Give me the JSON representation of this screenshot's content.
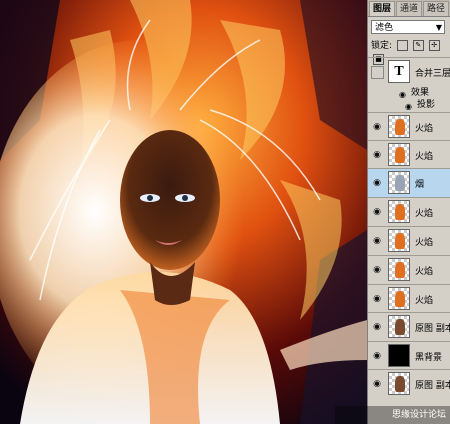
{
  "tabs": [
    "图层",
    "通道",
    "路径"
  ],
  "blend_mode": "滤色",
  "lock_label": "锁定:",
  "text_layer": {
    "thumb": "T",
    "name": "合并三层"
  },
  "effects": {
    "label": "效果",
    "drop_shadow": "投影"
  },
  "layers": [
    {
      "name": "火焰",
      "thumb": "fire"
    },
    {
      "name": "火焰",
      "thumb": "fire"
    },
    {
      "name": "烟",
      "thumb": "smoke",
      "selected": true
    },
    {
      "name": "火焰",
      "thumb": "fire"
    },
    {
      "name": "火焰",
      "thumb": "fire"
    },
    {
      "name": "火焰",
      "thumb": "fire"
    },
    {
      "name": "火焰",
      "thumb": "fire"
    },
    {
      "name": "原图 副本",
      "thumb": "photo"
    },
    {
      "name": "黑背景",
      "thumb": "black"
    },
    {
      "name": "原图 副本",
      "thumb": "photo"
    }
  ],
  "watermark": "思缘设计论坛"
}
